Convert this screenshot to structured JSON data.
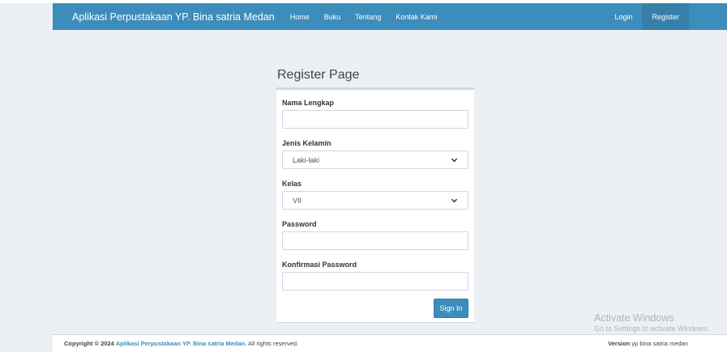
{
  "navbar": {
    "brand": "Aplikasi Perpustakaan YP. Bina satria Medan",
    "links": [
      {
        "label": "Home"
      },
      {
        "label": "Buku"
      },
      {
        "label": "Tentang"
      },
      {
        "label": "Kontak Kami"
      }
    ],
    "login_label": "Login",
    "register_label": "Register",
    "active": "Register"
  },
  "form": {
    "title": "Register Page",
    "nama_label": "Nama Lengkap",
    "nama_value": "",
    "jk_label": "Jenis Kelamin",
    "jk_selected": "Laki-laki",
    "kelas_label": "Kelas",
    "kelas_selected": "VII",
    "password_label": "Password",
    "password_value": "",
    "konfirmasi_label": "Konfirmasi Password",
    "konfirmasi_value": "",
    "submit_label": "Sign In"
  },
  "footer": {
    "copyright_prefix": "Copyright © 2024",
    "copyright_link": "Aplikasi Perpustakaan YP. Bina satria Medan.",
    "copyright_suffix": "All rights reserved.",
    "version_label": "Version",
    "version_value": "yp bina satria medan"
  },
  "watermark": {
    "title": "Activate Windows",
    "subtitle": "Go to Settings to activate Windows."
  },
  "colors": {
    "primary": "#3c8dbc",
    "primary_dark": "#367fa9",
    "background": "#ecf0f5"
  },
  "icons": {
    "select_arrow": "chevron-down-icon"
  }
}
